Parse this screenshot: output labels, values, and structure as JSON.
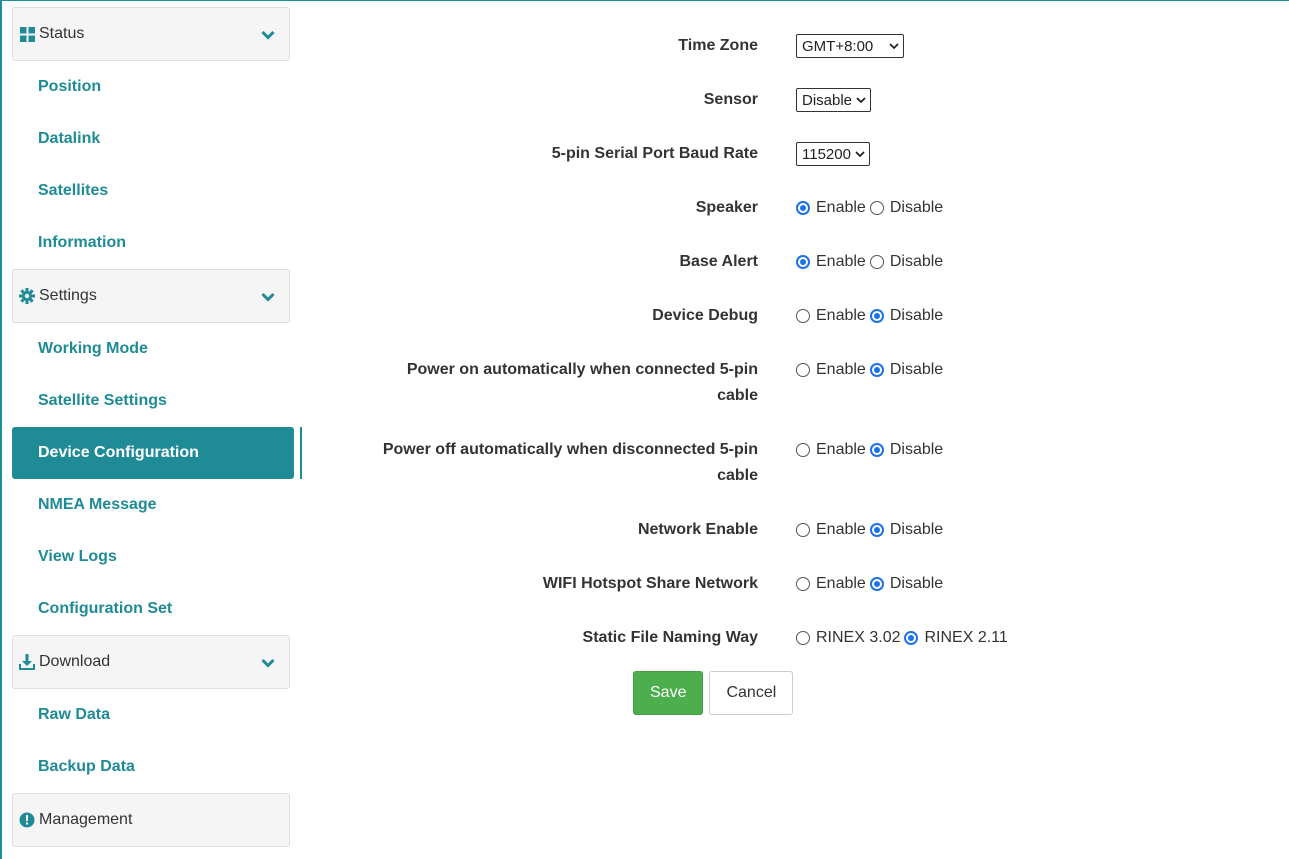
{
  "sidebar": {
    "status": {
      "label": "Status",
      "icon": "grid-icon"
    },
    "status_items": [
      "Position",
      "Datalink",
      "Satellites",
      "Information"
    ],
    "settings": {
      "label": "Settings",
      "icon": "gear-icon"
    },
    "settings_items": [
      "Working Mode",
      "Satellite Settings",
      "Device Configuration",
      "NMEA Message",
      "View Logs",
      "Configuration Set"
    ],
    "active_item": "Device Configuration",
    "download": {
      "label": "Download",
      "icon": "download-icon"
    },
    "download_items": [
      "Raw Data",
      "Backup Data"
    ],
    "management": {
      "label": "Management",
      "icon": "info-icon"
    }
  },
  "form": {
    "time_zone": {
      "label": "Time Zone",
      "value": "GMT+8:00"
    },
    "sensor": {
      "label": "Sensor",
      "value": "Disable"
    },
    "baud_rate": {
      "label": "5-pin Serial Port Baud Rate",
      "value": "115200"
    },
    "speaker": {
      "label": "Speaker",
      "opt1": "Enable",
      "opt2": "Disable",
      "selected": "Enable"
    },
    "base_alert": {
      "label": "Base Alert",
      "opt1": "Enable",
      "opt2": "Disable",
      "selected": "Enable"
    },
    "device_debug": {
      "label": "Device Debug",
      "opt1": "Enable",
      "opt2": "Disable",
      "selected": "Disable"
    },
    "power_on": {
      "label_line1": "Power on automatically when connected 5-pin",
      "label_line2": "cable",
      "opt1": "Enable",
      "opt2": "Disable",
      "selected": "Disable"
    },
    "power_off": {
      "label_line1": "Power off automatically when disconnected 5-pin",
      "label_line2": "cable",
      "opt1": "Enable",
      "opt2": "Disable",
      "selected": "Disable"
    },
    "network_enable": {
      "label": "Network Enable",
      "opt1": "Enable",
      "opt2": "Disable",
      "selected": "Disable"
    },
    "wifi_share": {
      "label": "WIFI Hotspot Share Network",
      "opt1": "Enable",
      "opt2": "Disable",
      "selected": "Disable"
    },
    "static_naming": {
      "label": "Static File Naming Way",
      "opt1": "RINEX 3.02",
      "opt2": "RINEX 2.11",
      "selected": "RINEX 2.11"
    },
    "save_label": "Save",
    "cancel_label": "Cancel"
  },
  "colors": {
    "accent": "#1e8b96",
    "save": "#4cae4c",
    "radio": "#1a73e8"
  }
}
